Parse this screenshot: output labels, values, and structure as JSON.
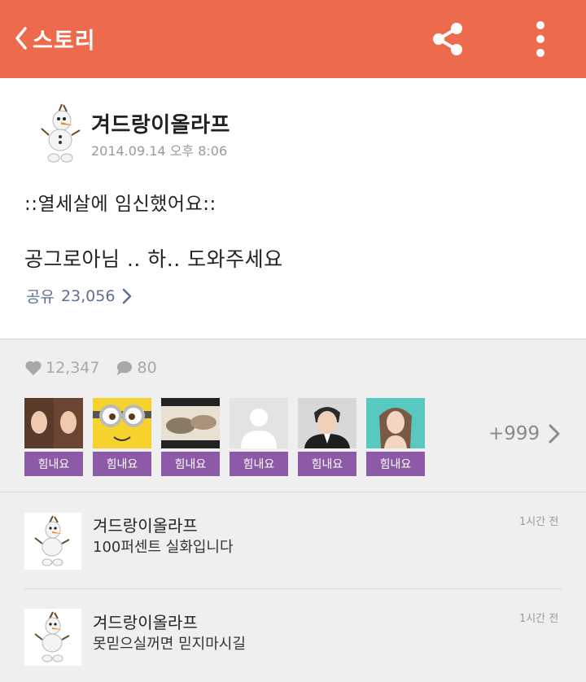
{
  "header": {
    "title": "스토리",
    "colors": {
      "background": "#ee6a4c",
      "foreground": "#ffffff"
    },
    "icons": [
      "back-chevron-icon",
      "share-icon",
      "more-vertical-icon"
    ]
  },
  "post": {
    "author": "겨드랑이올라프",
    "date": "2014.09.14 오후 8:06",
    "line1": "::열세살에 임신했어요::",
    "line2": "공그로아님 .. 하.. 도와주세요",
    "share_label": "공유",
    "share_count": "23,056"
  },
  "stats": {
    "likes": "12,347",
    "comments": "80"
  },
  "cheers": {
    "button_label": "힘내요",
    "button_color": "#8c5aa6",
    "more": "+999",
    "users": [
      "user-1",
      "user-2",
      "user-3",
      "user-4",
      "user-5",
      "user-6"
    ]
  },
  "comments": [
    {
      "author": "겨드랑이올라프",
      "text": "100퍼센트 실화입니다",
      "time": "1시간 전"
    },
    {
      "author": "겨드랑이올라프",
      "text": "못믿으실꺼면 믿지마시길",
      "time": "1시간 전"
    }
  ]
}
